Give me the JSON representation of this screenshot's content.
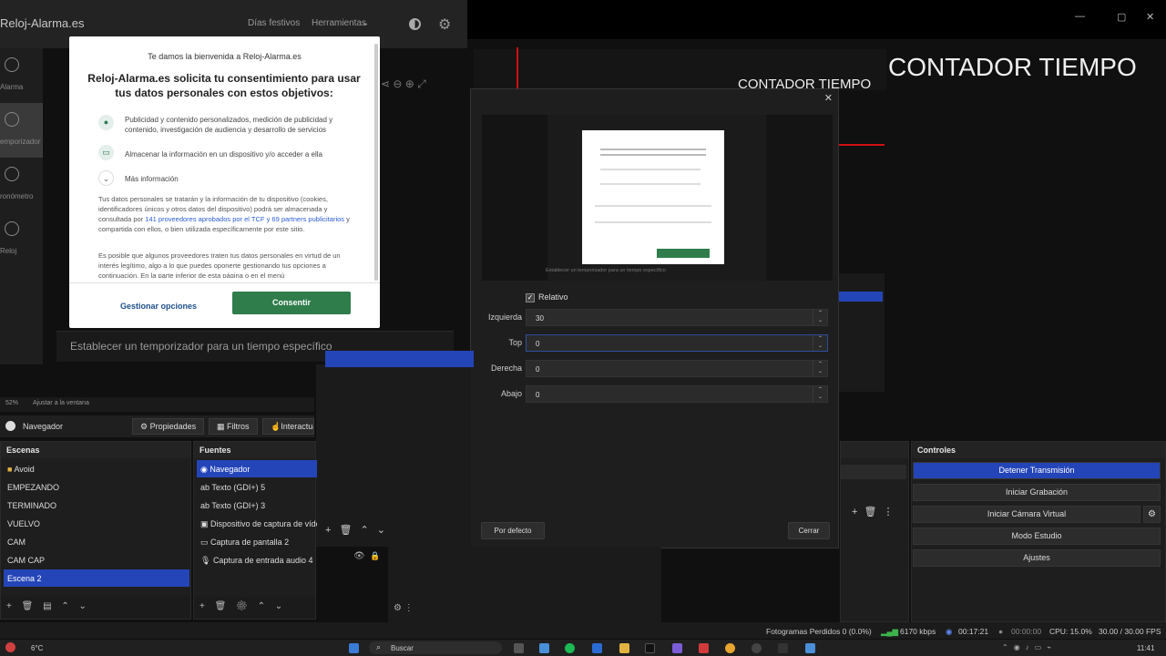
{
  "browser": {
    "site_name": "Reloj-Alarma.es",
    "nav": [
      "Días festivos",
      "Herramientas"
    ],
    "left_nav": [
      "Alarma",
      "emporizador",
      "ronómetro",
      "Reloj"
    ],
    "timer_bar": "Establecer un temporizador para un tiempo específico"
  },
  "consent": {
    "welcome": "Te damos la bienvenida a Reloj-Alarma.es",
    "title": "Reloj-Alarma.es solicita tu consentimiento para usar tus datos personales con estos objetivos:",
    "items": [
      "Publicidad y contenido personalizados, medición de publicidad y contenido, investigación de audiencia y desarrollo de servicios",
      "Almacenar la información en un dispositivo y/o acceder a ella"
    ],
    "more_info": "Más información",
    "para1_a": "Tus datos personales se tratarán y la información de tu dispositivo (cookies, identificadores únicos y otros datos del dispositivo) podrá ser almacenada y consultada por ",
    "para1_link": "141 proveedores aprobados por el TCF y 69 partners publicitarios",
    "para1_b": " y compartida con ellos, o bien utilizada específicamente por este sitio.",
    "para2": "Es posible que algunos proveedores traten tus datos personales en virtud de un interés legítimo, algo a lo que puedes oponerte gestionando tus opciones a continuación. En la parte inferior de esta página o en el menú",
    "manage_button": "Gestionar opciones",
    "accept_button": "Consentir"
  },
  "overlay": {
    "title_large": "CONTADOR TIEMPO",
    "title_small": "CONTADOR TIEMPO"
  },
  "dialog": {
    "relative_label": "Relativo",
    "fields": [
      {
        "label": "Izquierda",
        "value": "30"
      },
      {
        "label": "Top",
        "value": "0"
      },
      {
        "label": "Derecha",
        "value": "0"
      },
      {
        "label": "Abajo",
        "value": "0"
      }
    ],
    "default_button": "Por defecto",
    "close_button": "Cerrar",
    "preview_caption": "Establecer un temporizador para un tiempo específico"
  },
  "obs": {
    "zoom": "52%",
    "fit": "Ajustar a la ventana",
    "source_name": "Navegador",
    "toolbar": [
      "Propiedades",
      "Filtros",
      "Interactuar"
    ],
    "scenes_title": "Escenas",
    "scenes": [
      "Avoid",
      "EMPEZANDO",
      "TERMINADO",
      "VUELVO",
      "CAM",
      "CAM CAP",
      "Escena 2"
    ],
    "sources_title": "Fuentes",
    "sources": [
      "Navegador",
      "Texto (GDI+) 5",
      "Texto (GDI+) 3",
      "Dispositivo de captura de vídeo",
      "Captura de pantalla 2",
      "Captura de entrada audio 4"
    ],
    "controls_title": "Controles",
    "controls": [
      "Detener Transmisión",
      "Iniciar Grabación",
      "Iniciar Cámara Virtual",
      "Modo Estudio",
      "Ajustes"
    ]
  },
  "status": {
    "dropped": "Fotogramas Perdidos 0 (0.0%)",
    "bitrate": "6170 kbps",
    "stream_time": "00:17:21",
    "rec_time": "00:00:00",
    "cpu": "CPU: 15.0%",
    "fps": "30.00 / 30.00 FPS"
  },
  "taskbar": {
    "weather": "6°C",
    "search": "Buscar",
    "time": "11:41"
  },
  "colors": {
    "accent_blue": "#2445b8",
    "consent_green": "#2f7d4b",
    "red_marker": "#d01010"
  }
}
